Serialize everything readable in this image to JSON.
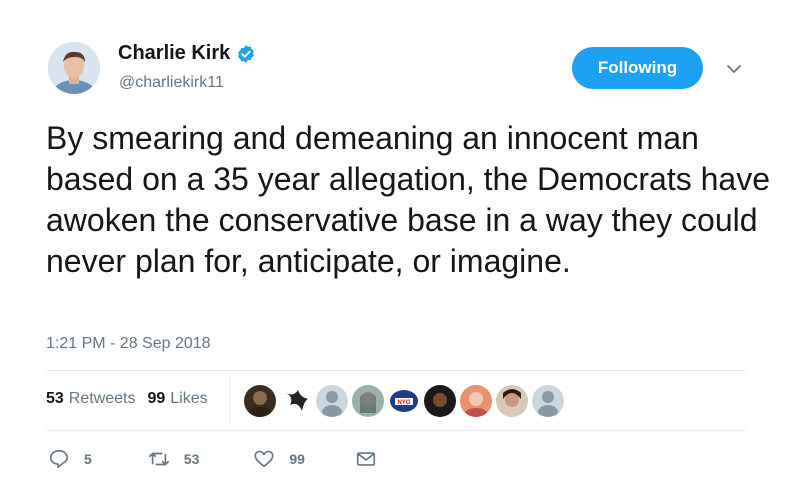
{
  "author": {
    "name": "Charlie Kirk",
    "handle": "@charliekirk11",
    "verified": true,
    "avatar_icon": "profile-photo"
  },
  "follow_button": {
    "label": "Following"
  },
  "tweet": {
    "text": "By smearing and demeaning an innocent man based on a 35 year allegation, the Democrats have awoken the conservative base in a way they could never plan for, anticipate, or imagine.",
    "timestamp": "1:21 PM - 28 Sep 2018"
  },
  "stats": {
    "retweets_count": "53",
    "retweets_label": "Retweets",
    "likes_count": "99",
    "likes_label": "Likes"
  },
  "actions": {
    "reply_count": "5",
    "retweet_count": "53",
    "like_count": "99"
  },
  "colors": {
    "accent": "#1da1f2",
    "muted": "#657786",
    "text": "#14171a",
    "divider": "#e6ecf0"
  }
}
